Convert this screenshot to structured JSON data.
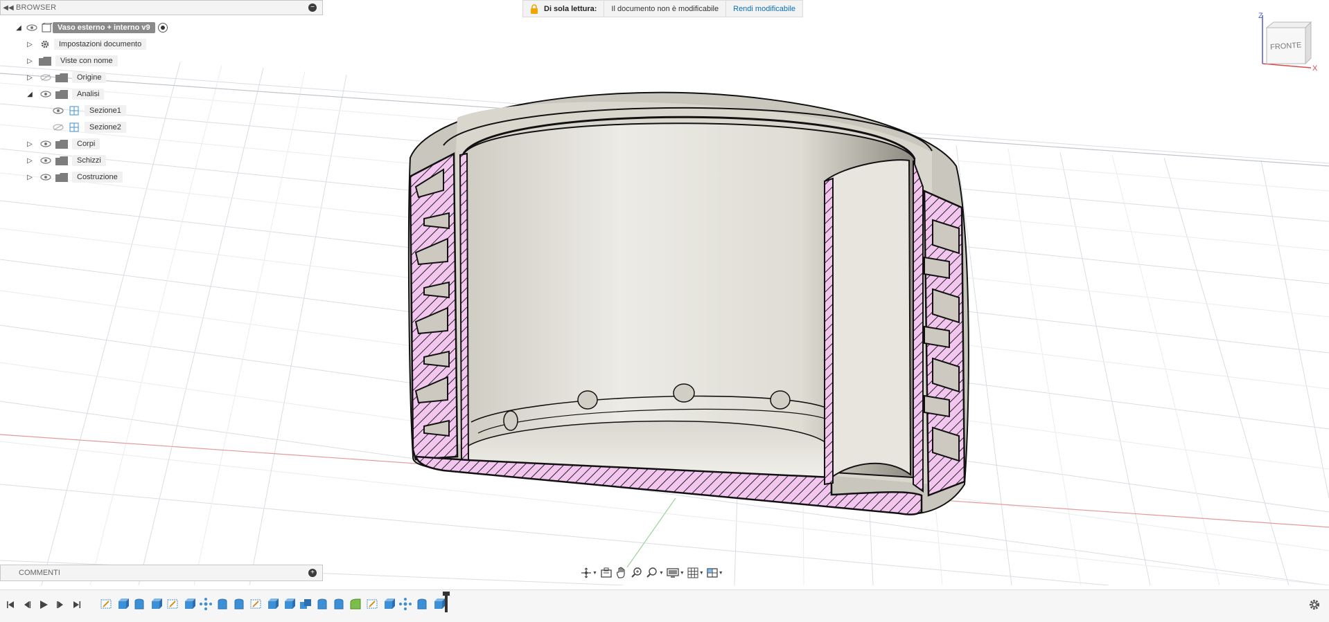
{
  "browser": {
    "title": "BROWSER",
    "root": "Vaso esterno + interno v9",
    "items": [
      {
        "label": "Impostazioni documento"
      },
      {
        "label": "Viste con nome"
      },
      {
        "label": "Origine"
      },
      {
        "label": "Analisi"
      },
      {
        "label": "Sezione1"
      },
      {
        "label": "Sezione2"
      },
      {
        "label": "Corpi"
      },
      {
        "label": "Schizzi"
      },
      {
        "label": "Costruzione"
      }
    ]
  },
  "readonly_banner": {
    "title": "Di sola lettura:",
    "message": "Il documento non è modificabile",
    "action": "Rendi modificabile"
  },
  "viewcube": {
    "face": "FRONTE",
    "axis_z": "Z",
    "axis_x": "X"
  },
  "comments": {
    "title": "COMMENTI"
  },
  "colors": {
    "section_fill": "#f2c4f0",
    "section_hatch": "#000000",
    "model_surface": "#e6e4dd",
    "accent_link": "#0d6fb8",
    "timeline_icon": "#3d8fd6"
  },
  "navbar_icons": [
    "orbit-icon",
    "look-at-icon",
    "pan-icon",
    "zoom-icon",
    "fit-icon",
    "display-settings-icon",
    "grid-icon",
    "viewports-icon"
  ],
  "timeline_features": [
    "sketch",
    "extrude",
    "revolve",
    "extrude",
    "sketch",
    "extrude",
    "pattern",
    "revolve",
    "revolve",
    "sketch",
    "extrude",
    "extrude",
    "combine",
    "revolve",
    "revolve",
    "fillet",
    "sketch",
    "extrude",
    "pattern",
    "revolve",
    "extrude"
  ]
}
